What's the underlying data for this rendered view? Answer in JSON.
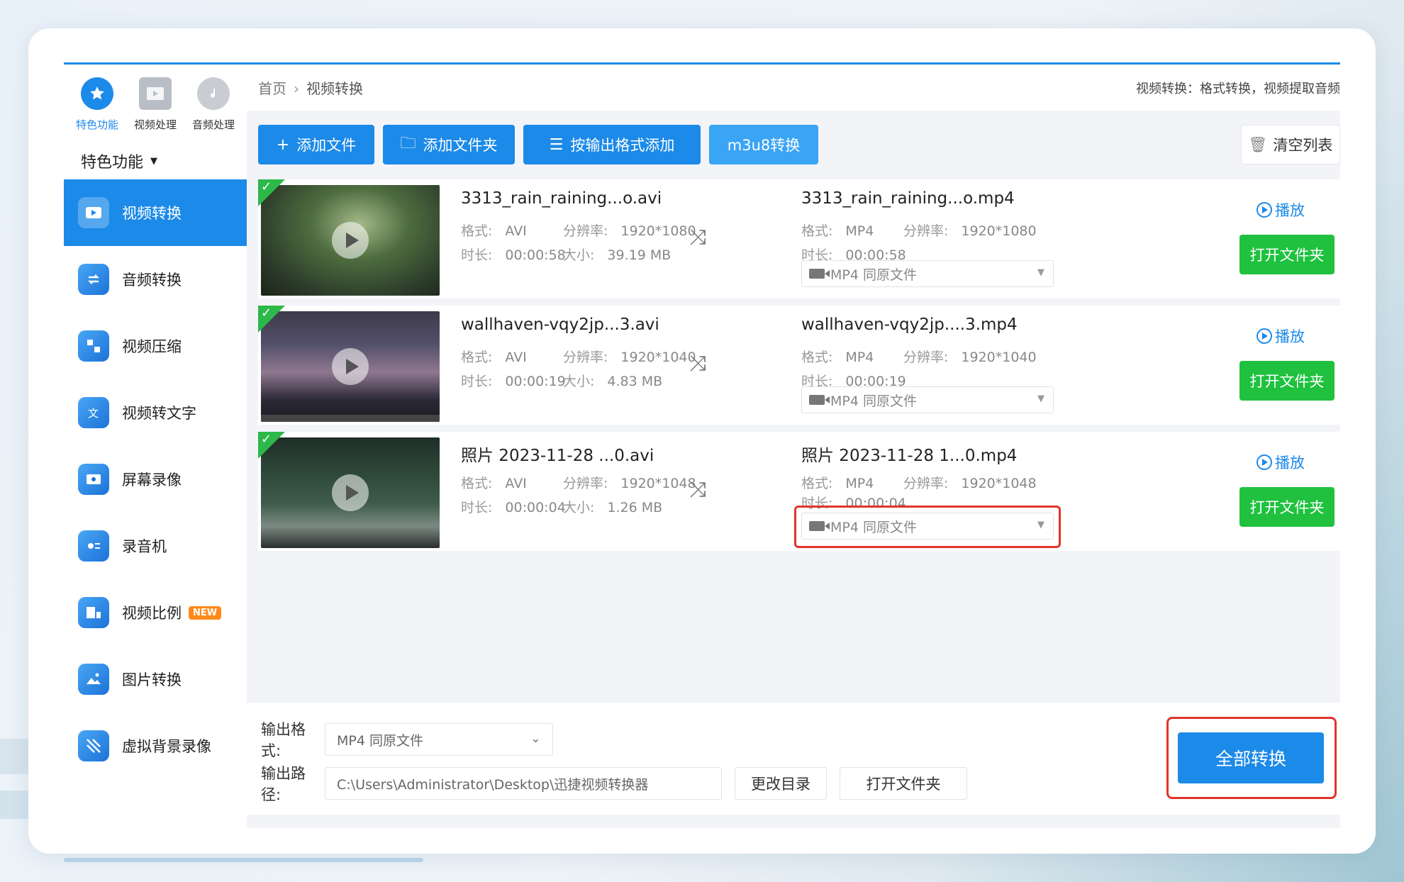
{
  "sidebar": {
    "top_tabs": [
      {
        "label": "特色功能",
        "icon": "star-icon"
      },
      {
        "label": "视频处理",
        "icon": "film-icon"
      },
      {
        "label": "音频处理",
        "icon": "music-icon"
      }
    ],
    "section_title": "特色功能",
    "items": [
      {
        "label": "视频转换",
        "icon": "video-convert-icon"
      },
      {
        "label": "音频转换",
        "icon": "audio-convert-icon"
      },
      {
        "label": "视频压缩",
        "icon": "video-compress-icon"
      },
      {
        "label": "视频转文字",
        "icon": "video-to-text-icon"
      },
      {
        "label": "屏幕录像",
        "icon": "screen-record-icon"
      },
      {
        "label": "录音机",
        "icon": "recorder-icon"
      },
      {
        "label": "视频比例",
        "icon": "aspect-ratio-icon",
        "badge": "NEW"
      },
      {
        "label": "图片转换",
        "icon": "image-convert-icon"
      },
      {
        "label": "虚拟背景录像",
        "icon": "virtual-bg-icon"
      }
    ]
  },
  "header": {
    "breadcrumb_home": "首页",
    "breadcrumb_sep": "›",
    "breadcrumb_current": "视频转换",
    "description": "视频转换：格式转换，视频提取音频"
  },
  "toolbar": {
    "add_file": "添加文件",
    "add_folder": "添加文件夹",
    "add_by_format": "按输出格式添加",
    "m3u8": "m3u8转换",
    "clear_list": "清空列表"
  },
  "labels": {
    "format": "格式:",
    "resolution": "分辨率:",
    "duration": "时长:",
    "size": "大小:",
    "play": "播放",
    "open_folder": "打开文件夹"
  },
  "files": [
    {
      "src_name": "3313_rain_raining...o.avi",
      "src_format": "AVI",
      "src_resolution": "1920*1080",
      "src_duration": "00:00:58",
      "src_size": "39.19 MB",
      "dst_name": "3313_rain_raining...o.mp4",
      "dst_format": "MP4",
      "dst_resolution": "1920*1080",
      "dst_duration": "00:00:58",
      "output_select": "MP4  同原文件"
    },
    {
      "src_name": "wallhaven-vqy2jp...3.avi",
      "src_format": "AVI",
      "src_resolution": "1920*1040",
      "src_duration": "00:00:19",
      "src_size": "4.83 MB",
      "dst_name": "wallhaven-vqy2jp....3.mp4",
      "dst_format": "MP4",
      "dst_resolution": "1920*1040",
      "dst_duration": "00:00:19",
      "output_select": "MP4  同原文件"
    },
    {
      "src_name": "照片 2023-11-28 ...0.avi",
      "src_format": "AVI",
      "src_resolution": "1920*1048",
      "src_duration": "00:00:04",
      "src_size": "1.26 MB",
      "dst_name": "照片 2023-11-28 1...0.mp4",
      "dst_format": "MP4",
      "dst_resolution": "1920*1048",
      "dst_duration": "00:00:04",
      "output_select": "MP4  同原文件"
    }
  ],
  "footer": {
    "output_format_label": "输出格式:",
    "output_format_value": "MP4  同原文件",
    "output_path_label": "输出路径:",
    "output_path_value": "C:\\Users\\Administrator\\Desktop\\迅捷视频转换器",
    "change_dir": "更改目录",
    "open_folder": "打开文件夹",
    "convert_all": "全部转换"
  },
  "colors": {
    "accent": "#1c8ae8",
    "green": "#1fc13f",
    "highlight_red": "#e0352b"
  }
}
